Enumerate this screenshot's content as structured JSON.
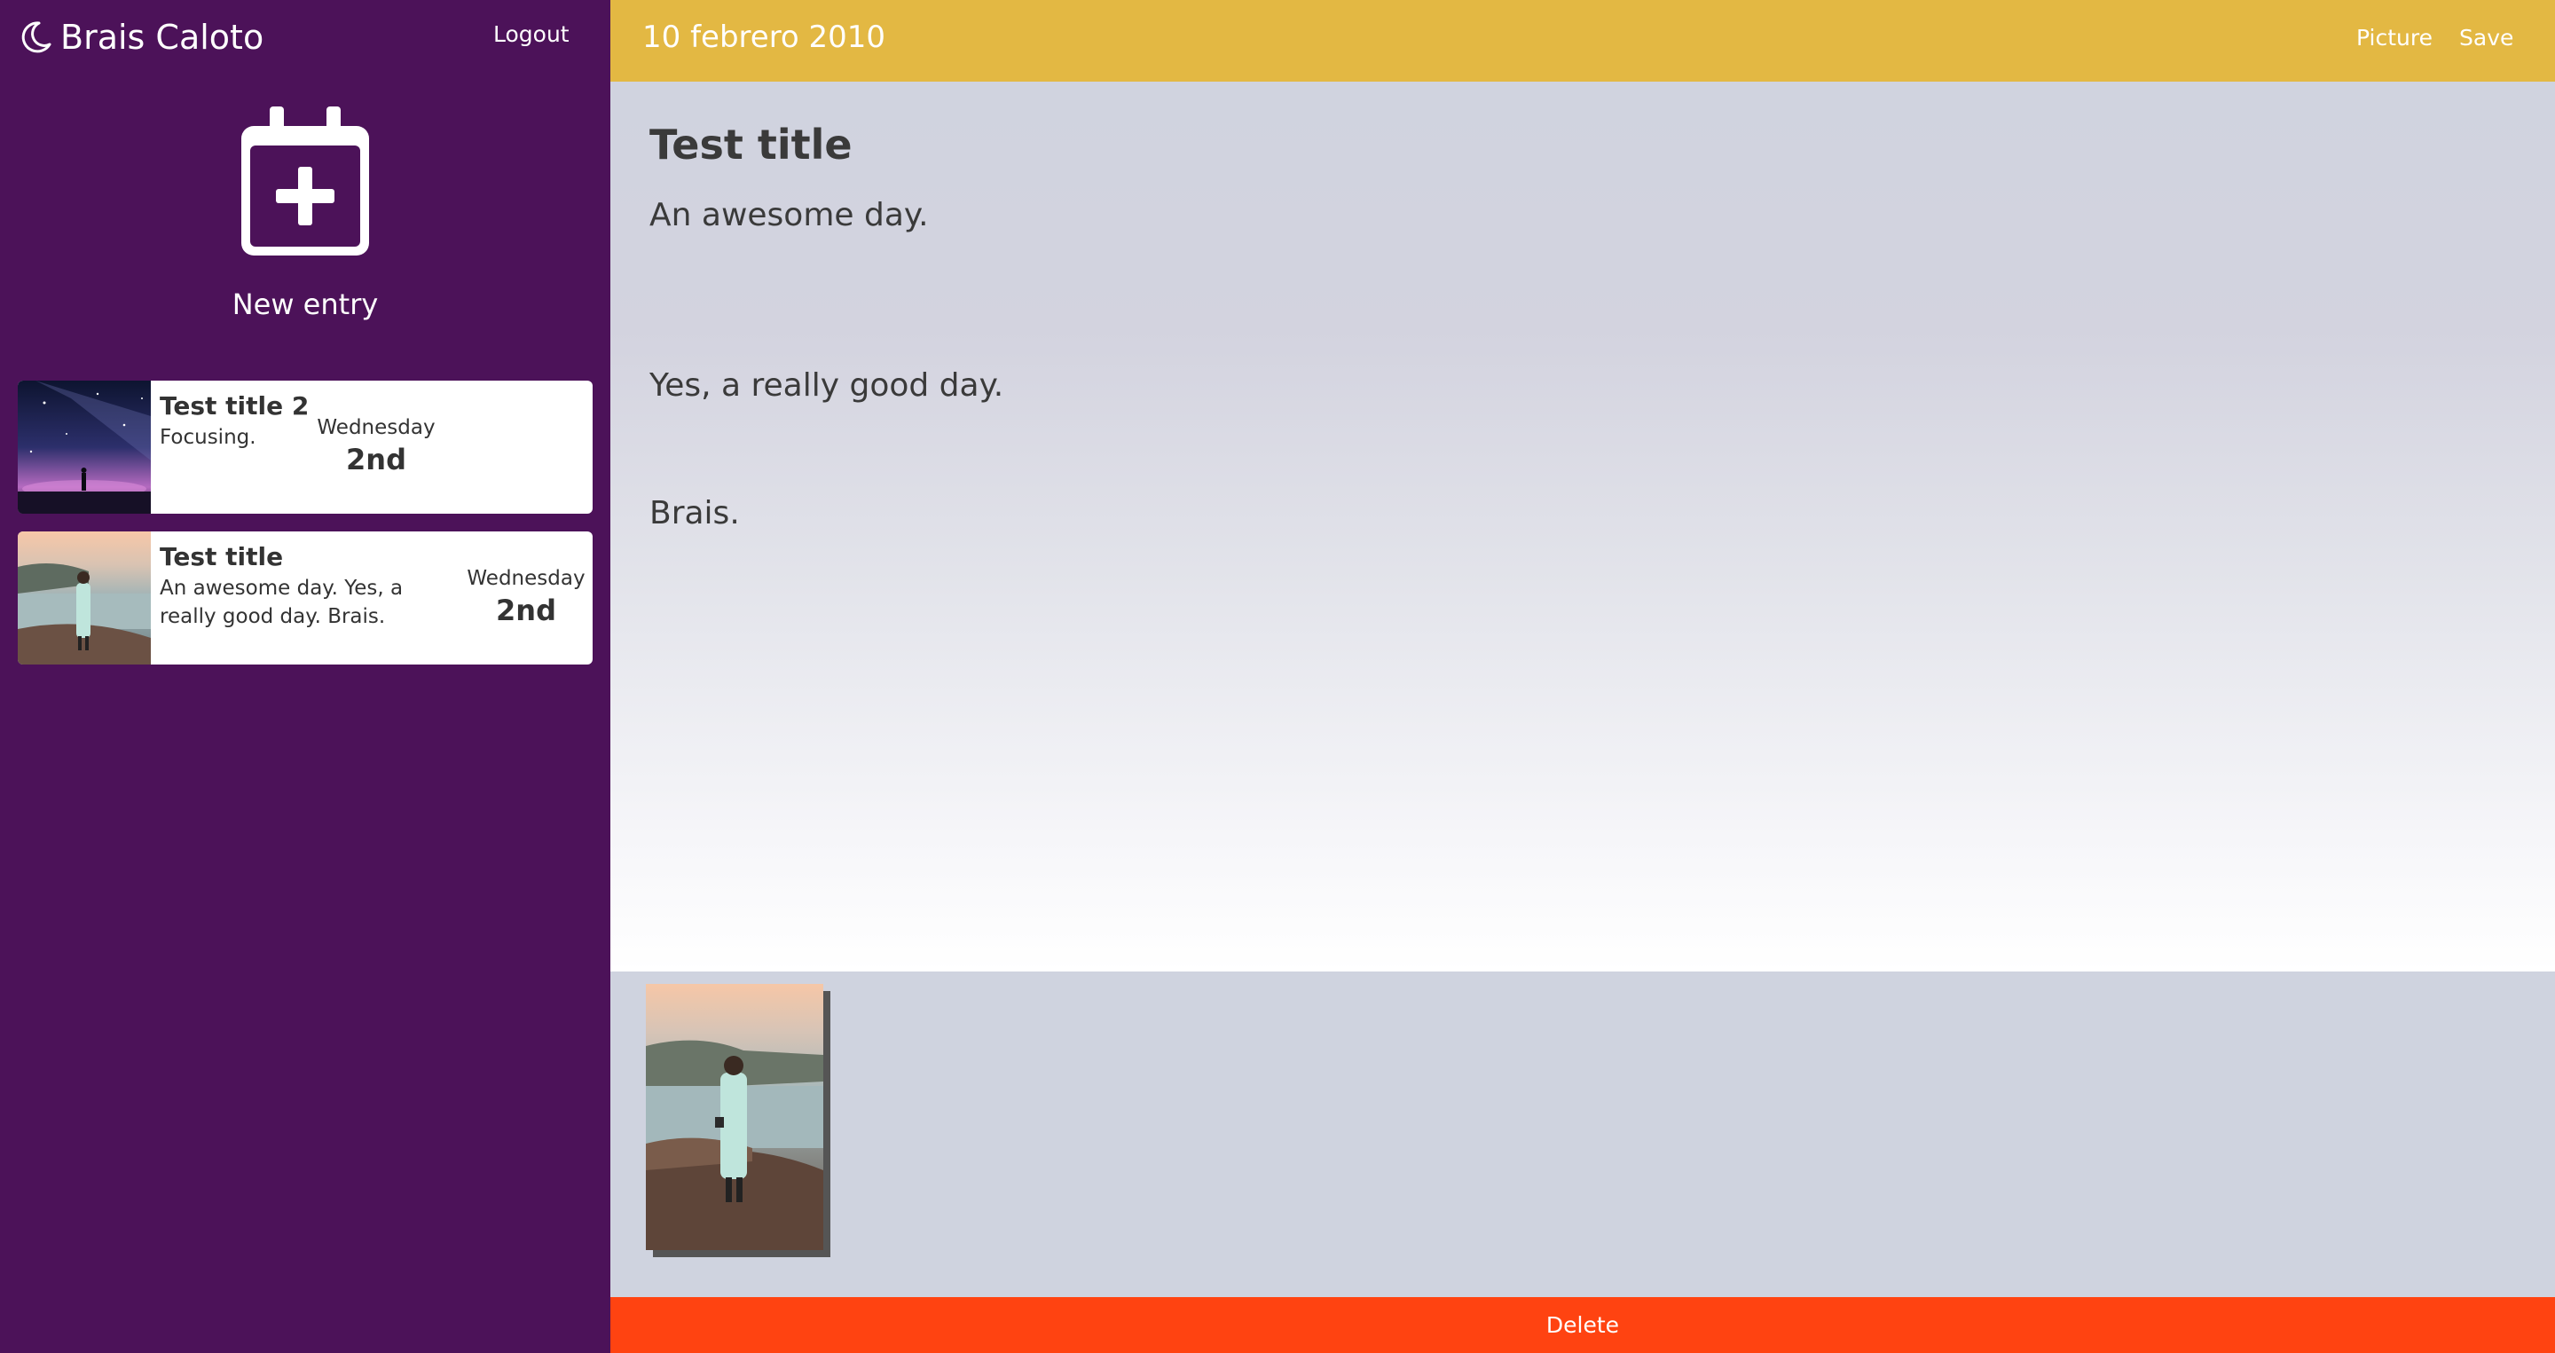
{
  "sidebar": {
    "brand_name": "Brais Caloto",
    "logout_label": "Logout",
    "new_entry_label": "New entry",
    "entries": [
      {
        "title": "Test title 2",
        "excerpt": "Focusing.",
        "weekday": "Wednesday",
        "day": "2nd",
        "thumbnail": "night-sky-milky-way"
      },
      {
        "title": "Test title",
        "excerpt": "An awesome day. Yes, a really good day. Brais.",
        "weekday": "Wednesday",
        "day": "2nd",
        "thumbnail": "woman-on-coast"
      }
    ]
  },
  "topbar": {
    "date": "10 febrero 2010",
    "picture_label": "Picture",
    "save_label": "Save"
  },
  "editor": {
    "title": "Test title",
    "paragraphs": [
      "An awesome day.",
      "Yes, a really good day.",
      "Brais."
    ]
  },
  "gallery": {
    "images": [
      "woman-on-coast"
    ]
  },
  "delete_label": "Delete",
  "colors": {
    "sidebar": "#4c1259",
    "topbar": "#e3b843",
    "delete": "#ff4311",
    "gallery": "#cfd3df"
  }
}
